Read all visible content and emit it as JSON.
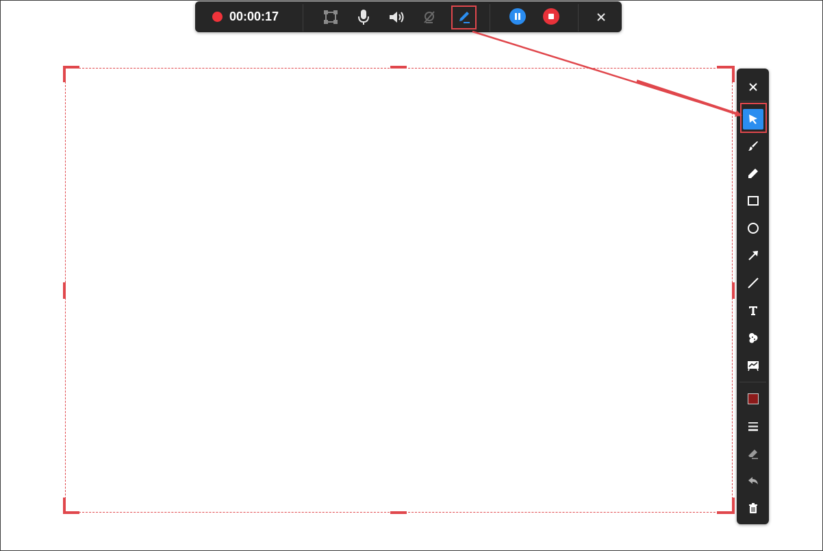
{
  "recorder": {
    "timer": "00:00:17",
    "status_color": "#f0333a",
    "top_toolbar": {
      "items": [
        {
          "name": "region-icon"
        },
        {
          "name": "microphone-icon"
        },
        {
          "name": "speaker-icon"
        },
        {
          "name": "webcam-off-icon"
        },
        {
          "name": "annotate-pen-icon",
          "highlighted": true
        },
        {
          "name": "pause-icon",
          "color": "#2a8cf0"
        },
        {
          "name": "stop-icon",
          "color": "#e8323a"
        },
        {
          "name": "close-icon"
        }
      ]
    },
    "annotation_toolbar": {
      "tools": [
        {
          "name": "close-icon"
        },
        {
          "name": "select-cursor-icon",
          "active": true,
          "color": "#2b8ef0"
        },
        {
          "name": "brush-icon"
        },
        {
          "name": "pencil-icon"
        },
        {
          "name": "rectangle-icon"
        },
        {
          "name": "circle-icon"
        },
        {
          "name": "arrow-icon"
        },
        {
          "name": "line-icon"
        },
        {
          "name": "text-icon"
        },
        {
          "name": "blur-icon"
        },
        {
          "name": "highlight-icon"
        },
        {
          "name": "color-swatch",
          "color": "#8b1a1a"
        },
        {
          "name": "line-width-icon"
        },
        {
          "name": "eraser-icon"
        },
        {
          "name": "undo-icon"
        },
        {
          "name": "trash-icon"
        }
      ]
    },
    "accent_color": "#e0474c"
  }
}
